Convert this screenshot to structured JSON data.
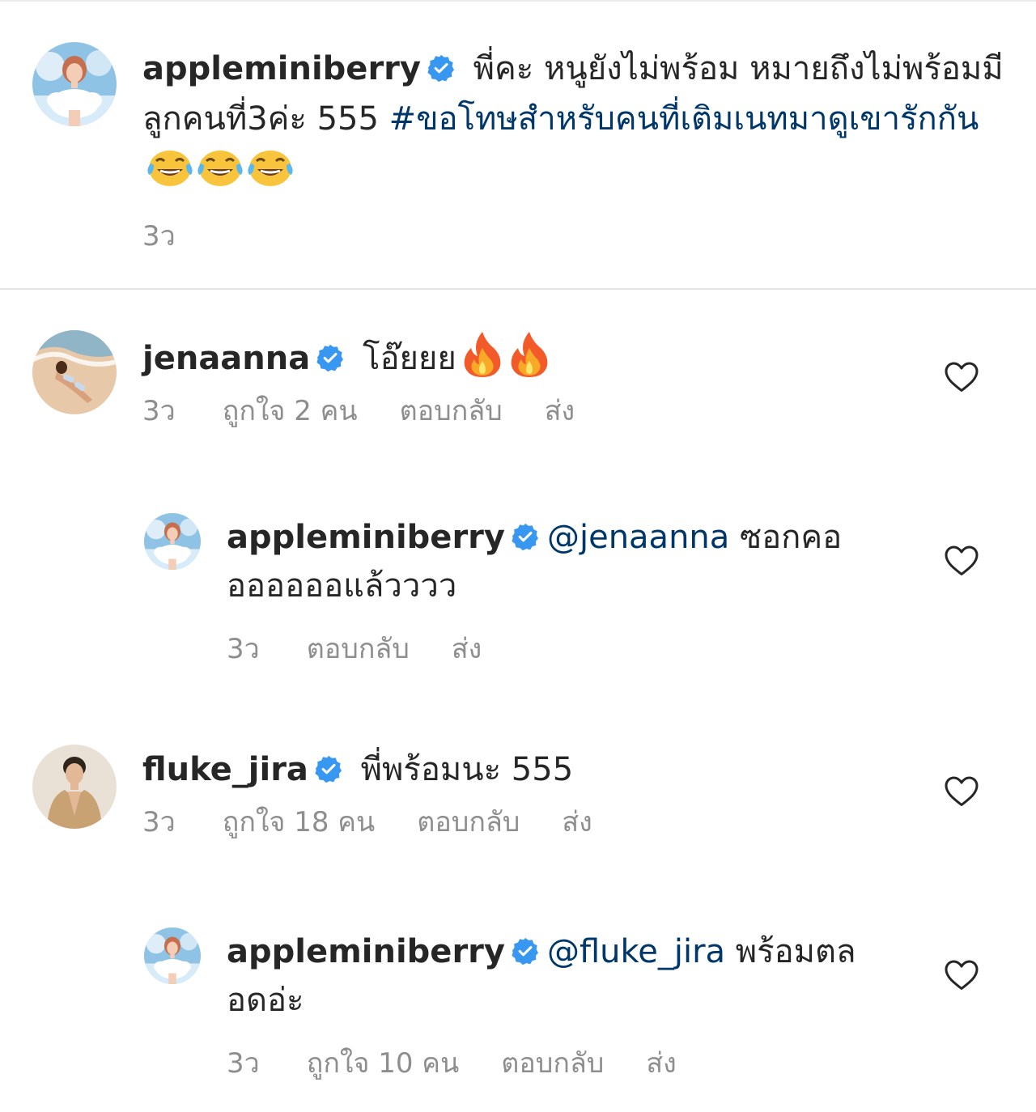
{
  "caption": {
    "username": "appleminiberry",
    "text_1": " พี่คะ หนูยังไม่พร้อม หมายถึงไม่พร้อมมีลูกคนที่3ค่ะ 555 ",
    "hashtag": "#ขอโทษสำหรับคนที่เติมเนทมาดูเขารักกัน",
    "emojis": [
      "face-with-tears-of-joy",
      "face-with-tears-of-joy",
      "face-with-tears-of-joy"
    ],
    "time": "3ว"
  },
  "comments": [
    {
      "username": "jenaanna",
      "text": " โอ๊ยยย",
      "emojis": [
        "fire",
        "fire"
      ],
      "time": "3ว",
      "likes": "ถูกใจ 2 คน",
      "reply": "ตอบกลับ",
      "send": "ส่ง"
    },
    {
      "username": "appleminiberry",
      "mention": "@jenaanna",
      "text": " ซอกคอออออออแล้วววว",
      "time": "3ว",
      "reply": "ตอบกลับ",
      "send": "ส่ง"
    },
    {
      "username": "fluke_jira",
      "text": " พี่พร้อมนะ 555",
      "time": "3ว",
      "likes": "ถูกใจ 18 คน",
      "reply": "ตอบกลับ",
      "send": "ส่ง"
    },
    {
      "username": "appleminiberry",
      "mention": "@fluke_jira",
      "text": " พร้อมตลอดอ่ะ",
      "time": "3ว",
      "likes": "ถูกใจ 10 คน",
      "reply": "ตอบกลับ",
      "send": "ส่ง"
    }
  ],
  "colors": {
    "text": "#262626",
    "muted": "#8e8e8e",
    "link": "#00376b",
    "verified": "#3897f0",
    "divider": "#e4e4e4"
  },
  "icons": {
    "verified": "verified-badge-icon",
    "like": "heart-icon"
  }
}
